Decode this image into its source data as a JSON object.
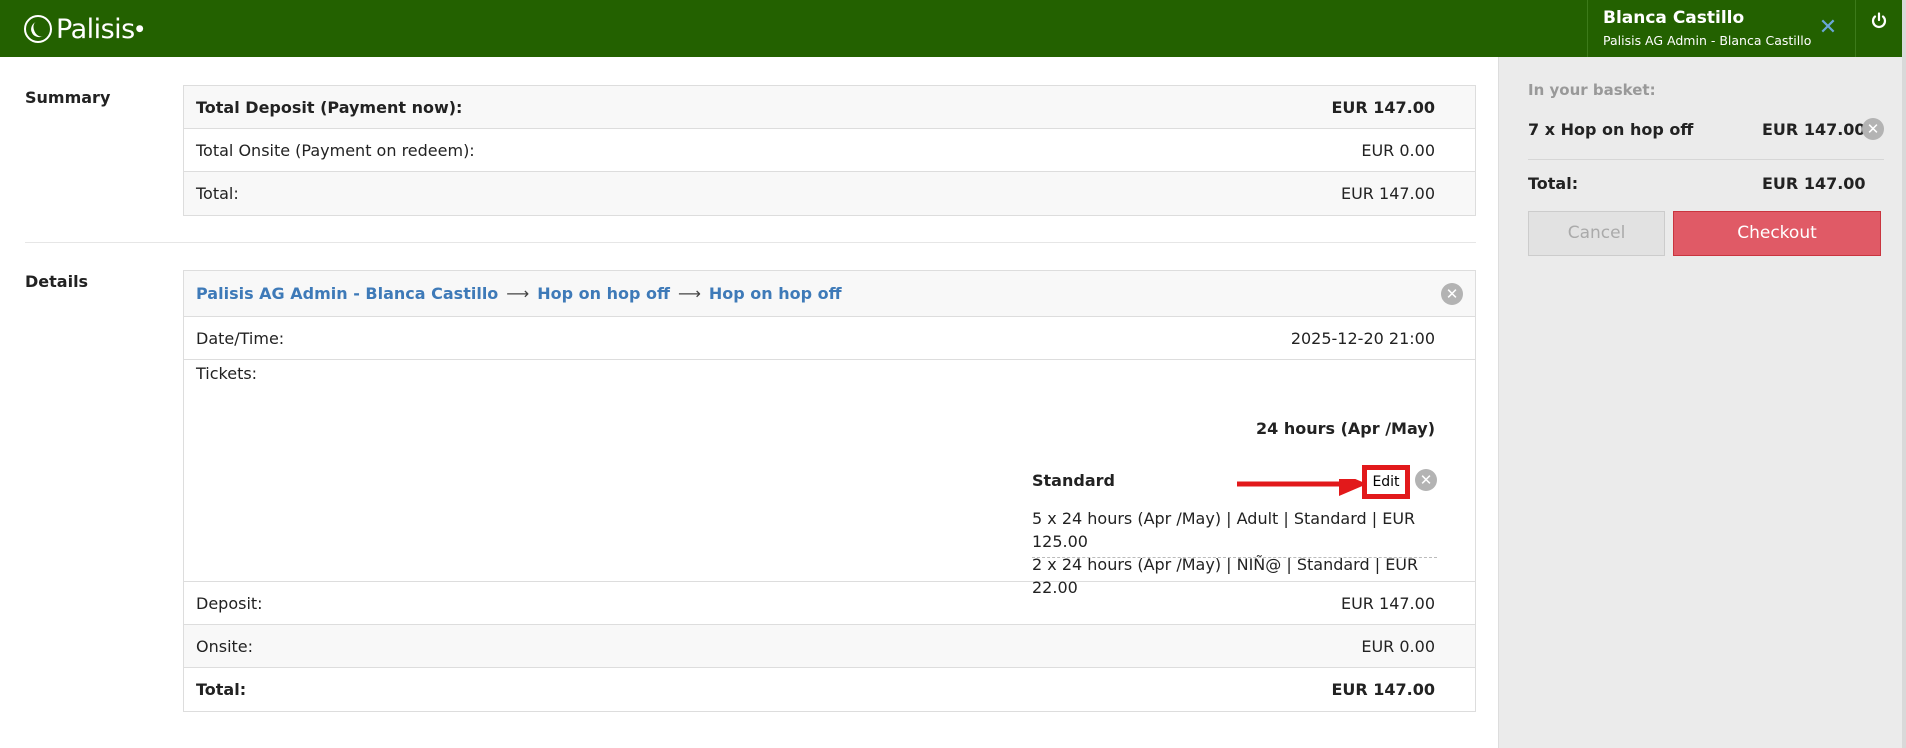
{
  "header": {
    "logo_text": "Palisis",
    "user_name": "Blanca Castillo",
    "user_role": "Palisis AG Admin - Blanca Castillo"
  },
  "summary": {
    "label": "Summary",
    "rows": [
      {
        "label": "Total Deposit (Payment now):",
        "value": "EUR 147.00"
      },
      {
        "label": "Total Onsite (Payment on redeem):",
        "value": "EUR 0.00"
      },
      {
        "label": "Total:",
        "value": "EUR 147.00"
      }
    ]
  },
  "details": {
    "label": "Details",
    "breadcrumb": [
      "Palisis AG Admin - Blanca Castillo",
      "Hop on hop off",
      "Hop on hop off"
    ],
    "breadcrumb_sep": "⟶",
    "datetime_label": "Date/Time:",
    "datetime_value": "2025-12-20 21:00",
    "tickets_label": "Tickets:",
    "ticket_title": "24 hours (Apr /May)",
    "category_name": "Standard",
    "edit_label": "Edit",
    "line_items": [
      "5 x 24 hours (Apr /May) | Adult | Standard | EUR 125.00",
      "2 x 24 hours (Apr /May) | NIÑ@ | Standard | EUR 22.00"
    ],
    "totals": [
      {
        "label": "Deposit:",
        "value": "EUR 147.00"
      },
      {
        "label": "Onsite:",
        "value": "EUR 0.00"
      },
      {
        "label": "Total:",
        "value": "EUR 147.00"
      }
    ]
  },
  "basket": {
    "label": "In your basket:",
    "item_label": "7 x Hop on hop off",
    "item_price": "EUR 147.00",
    "total_label": "Total:",
    "total_value": "EUR 147.00",
    "cancel_label": "Cancel",
    "checkout_label": "Checkout"
  },
  "icons": {
    "logo": "palisis-logo-icon",
    "tools": "tools-icon",
    "power": "power-icon",
    "remove": "remove-circle-icon",
    "annotation": "red-arrow-annotation"
  },
  "colors": {
    "header_bg": "#236100",
    "link": "#3e7ab8",
    "checkout": "#e05a66",
    "annotation": "#e2191b"
  }
}
